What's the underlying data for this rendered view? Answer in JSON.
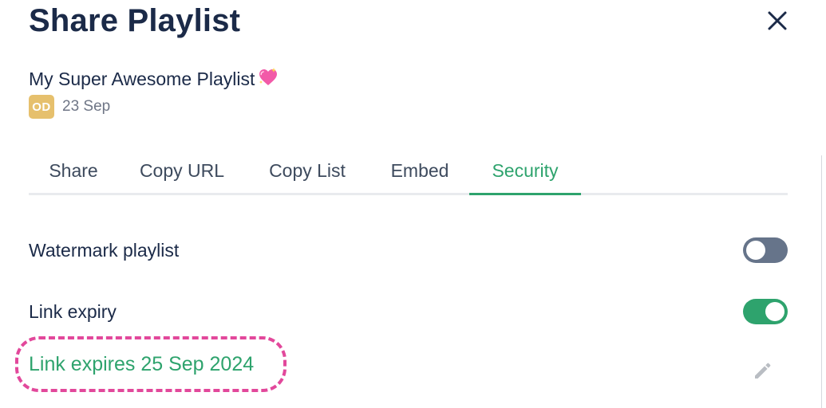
{
  "dialog": {
    "title": "Share Playlist"
  },
  "playlist": {
    "name": "My Super Awesome Playlist",
    "name_icon": "sparkling-heart-icon",
    "owner_initials": "OD",
    "date": "23 Sep"
  },
  "tabs": [
    {
      "label": "Share",
      "active": false
    },
    {
      "label": "Copy URL",
      "active": false
    },
    {
      "label": "Copy List",
      "active": false
    },
    {
      "label": "Embed",
      "active": false
    },
    {
      "label": "Security",
      "active": true
    }
  ],
  "security": {
    "watermark": {
      "label": "Watermark playlist",
      "enabled": false
    },
    "link_expiry": {
      "label": "Link expiry",
      "enabled": true
    },
    "expiry_text": "Link expires 25 Sep 2024",
    "edit_icon": "pencil-icon"
  },
  "colors": {
    "accent": "#2ea36d",
    "title": "#1b2a48",
    "toggle_off": "#66748a",
    "avatar": "#e6c06d",
    "highlight": "#e2489b"
  }
}
